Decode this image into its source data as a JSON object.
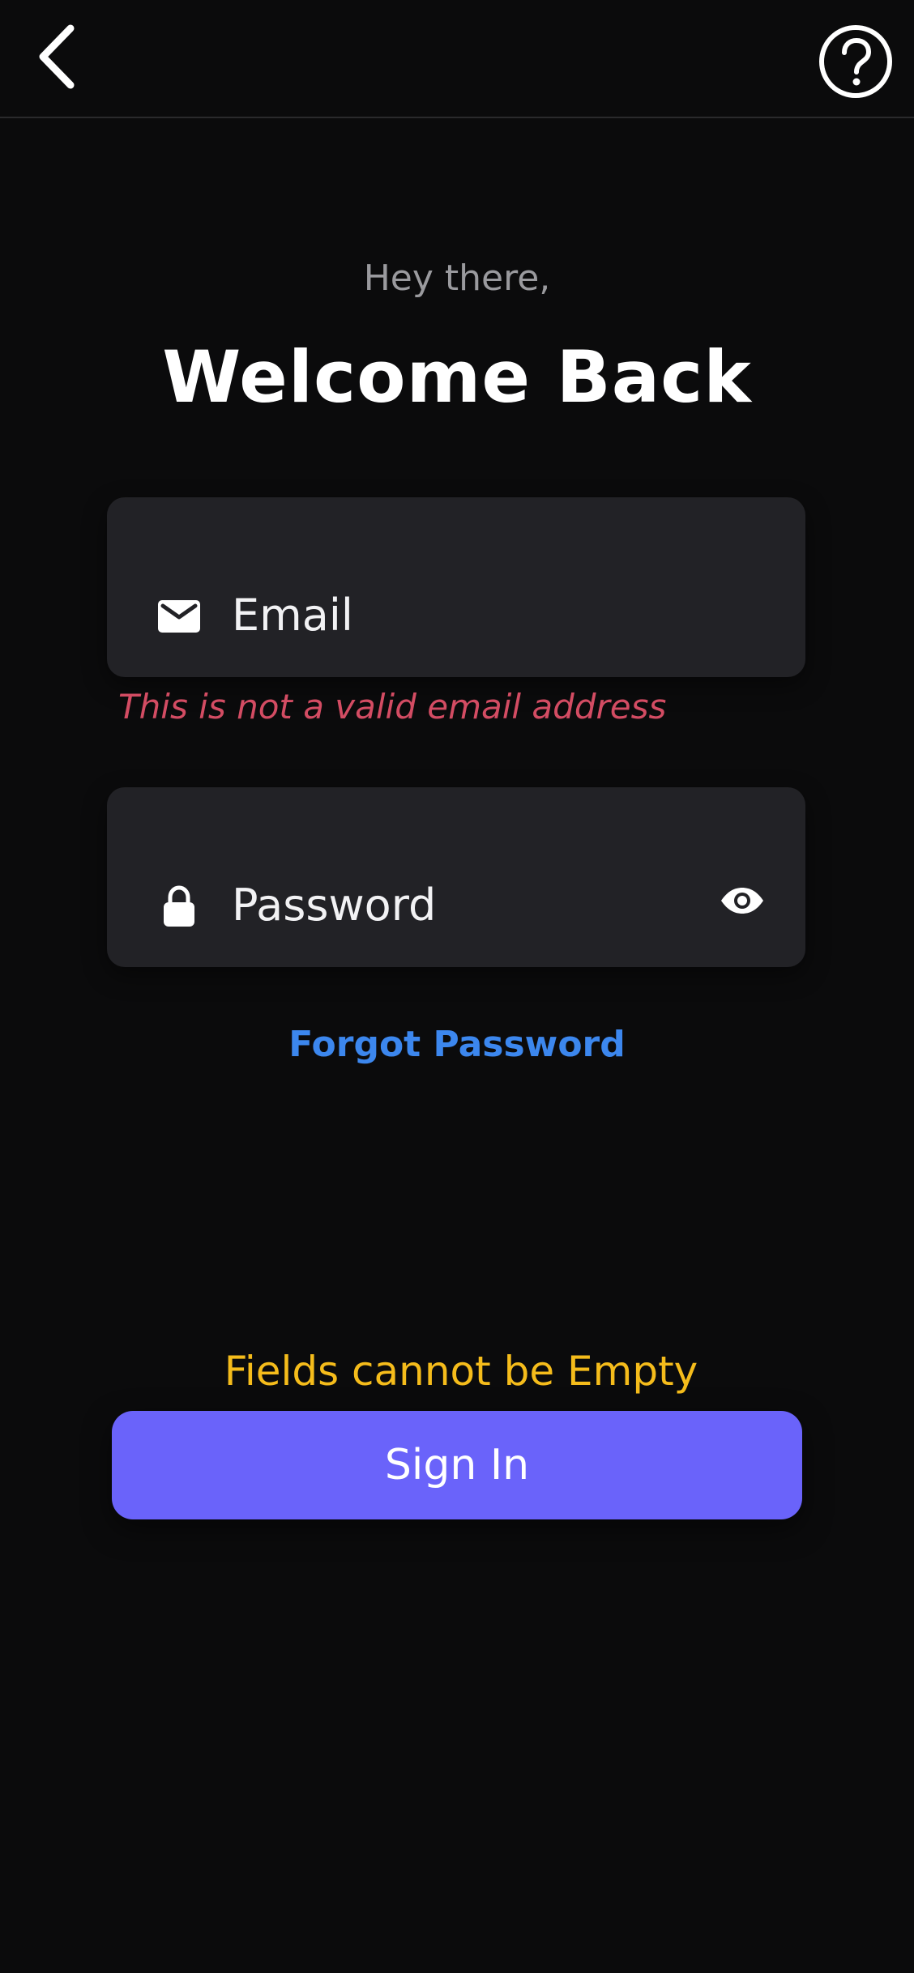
{
  "header": {
    "back_icon": "chevron-left-icon",
    "help_icon": "question-circle-icon"
  },
  "greeting": "Hey there,",
  "title": "Welcome Back",
  "email_field": {
    "placeholder": "Email",
    "value": "",
    "icon": "envelope-icon",
    "error": "This is not a valid email address"
  },
  "password_field": {
    "placeholder": "Password",
    "value": "",
    "icon": "lock-icon",
    "toggle_icon": "eye-icon"
  },
  "forgot_password_label": "Forgot Password",
  "form_warning": "Fields cannot be Empty",
  "sign_in_label": "Sign In",
  "colors": {
    "background": "#0b0b0c",
    "field_background": "#222226",
    "error": "#d34c63",
    "link": "#3c87ee",
    "warning": "#f5bc1b",
    "primary": "#6a63fa"
  }
}
